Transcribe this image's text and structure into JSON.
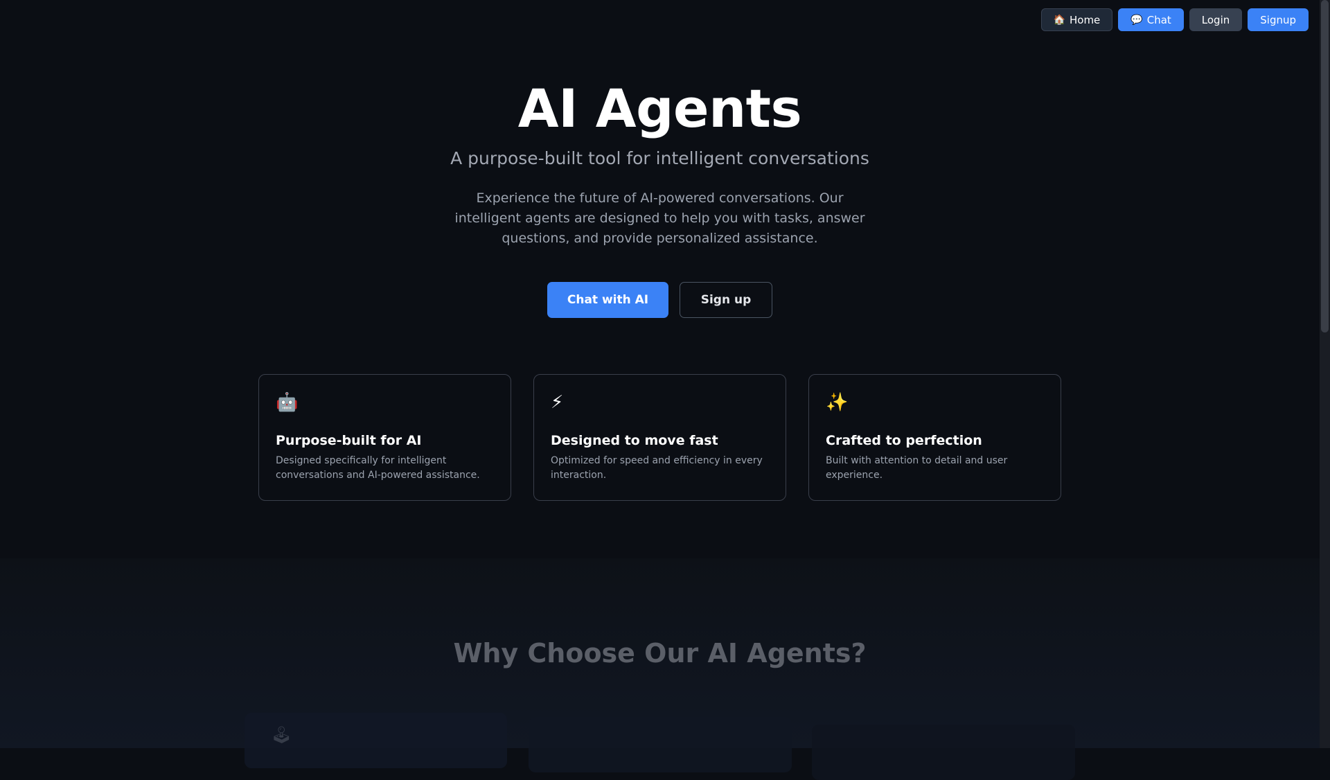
{
  "nav": {
    "home": {
      "icon": "🏠",
      "label": "Home"
    },
    "chat": {
      "icon": "💬",
      "label": "Chat"
    },
    "login": "Login",
    "signup": "Signup"
  },
  "hero": {
    "title": "AI Agents",
    "subtitle": "A purpose-built tool for intelligent conversations",
    "description": "Experience the future of AI-powered conversations. Our intelligent agents are designed to help you with tasks, answer questions, and provide personalized assistance.",
    "primary_cta": "Chat with AI",
    "secondary_cta": "Sign up"
  },
  "features": [
    {
      "icon": "🤖",
      "title": "Purpose-built for AI",
      "description": "Designed specifically for intelligent conversations and AI-powered assistance."
    },
    {
      "icon": "⚡",
      "title": "Designed to move fast",
      "description": "Optimized for speed and efficiency in every interaction."
    },
    {
      "icon": "✨",
      "title": "Crafted to perfection",
      "description": "Built with attention to detail and user experience."
    }
  ],
  "why": {
    "title": "Why Choose Our AI Agents?",
    "ghost_icons": [
      "🕹",
      "",
      ""
    ]
  },
  "colors": {
    "background": "#0b0e14",
    "accent": "#3b82f6",
    "card_border": "#3a3f4b"
  }
}
